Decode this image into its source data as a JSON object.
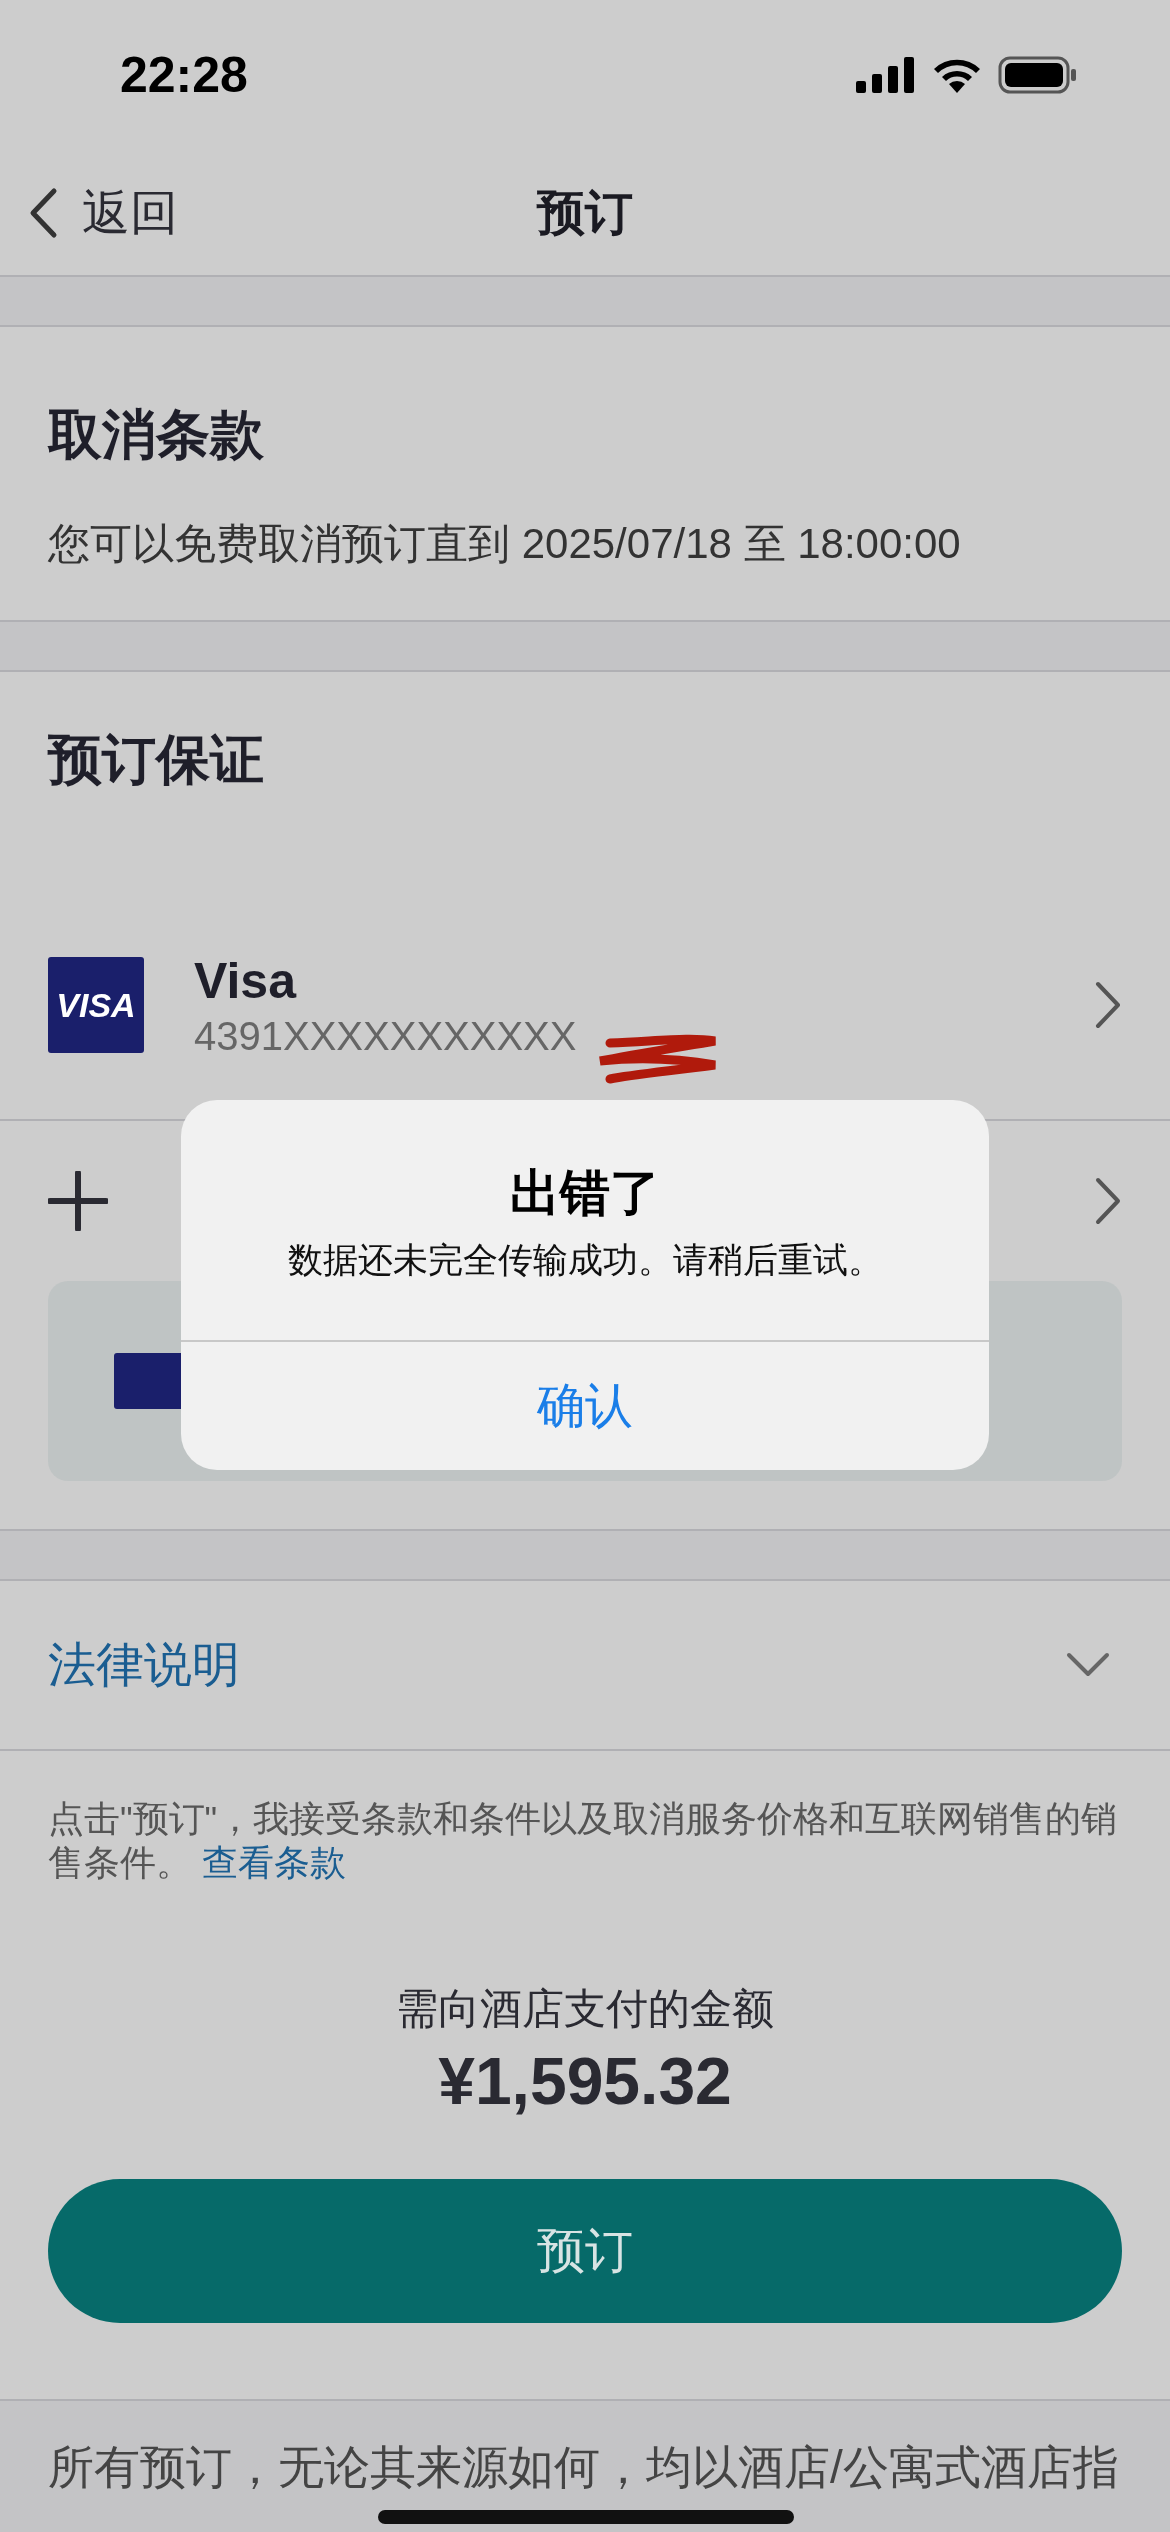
{
  "status_bar": {
    "time": "22:28"
  },
  "nav": {
    "back": "返回",
    "title": "预订"
  },
  "cancellation": {
    "title": "取消条款",
    "text": "您可以免费取消预订直到 2025/07/18 至 18:00:00"
  },
  "guarantee": {
    "title": "预订保证",
    "card": {
      "logo": "VISA",
      "brand": "Visa",
      "number": "4391XXXXXXXXXXX"
    }
  },
  "legal": {
    "title": "法律说明",
    "expanded": false
  },
  "terms": {
    "text": "点击\"预订\"，我接受条款和条件以及取消服务价格和互联网销售的销售条件。",
    "link": "查看条款"
  },
  "total": {
    "label": "需向酒店支付的金额",
    "amount": "¥1,595.32"
  },
  "book_button": "预订",
  "footer_text": "所有预订，无论其来源如何，均以酒店/公寓式酒店指",
  "alert": {
    "title": "出错了",
    "message": "数据还未完全传输成功。请稍后重试。",
    "button": "确认"
  }
}
